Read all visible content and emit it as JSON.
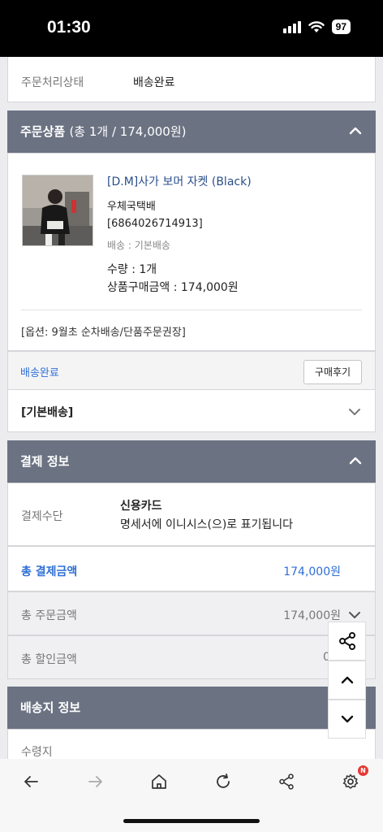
{
  "status_bar": {
    "time": "01:30",
    "battery": "97"
  },
  "order_status": {
    "label": "주문처리상태",
    "value": "배송완료"
  },
  "products_section": {
    "title": "주문상품",
    "summary": "(총 1개 / 174,000원)",
    "product": {
      "name": "[D.M]사가 보머 자켓 (Black)",
      "carrier": "우체국택배",
      "tracking": "[6864026714913]",
      "shipping_type": "배송 : 기본배송",
      "quantity": "수량 : 1개",
      "price": "상품구매금액 : 174,000원",
      "option": "[옵션: 9월초 순차배송/단품주문권장]"
    },
    "delivery_status": "배송완료",
    "review_button": "구매후기",
    "basic_shipping": "[기본배송]"
  },
  "payment_section": {
    "title": "결제 정보",
    "method_label": "결제수단",
    "method_value": "신용카드",
    "method_note": "명세서에 이니시스(으)로 표기됩니다",
    "total_label": "총 결제금액",
    "total_value": "174,000원",
    "order_total_label": "총 주문금액",
    "order_total_value": "174,000원",
    "discount_label": "총 할인금액",
    "discount_value": "0"
  },
  "shipping_section": {
    "title": "배송지 정보",
    "recipient_label": "수령지"
  },
  "colors": {
    "header_bg": "#6b7282",
    "accent": "#2f6fd6",
    "badge": "#e53935"
  },
  "nav": {
    "settings_badge": "N"
  }
}
